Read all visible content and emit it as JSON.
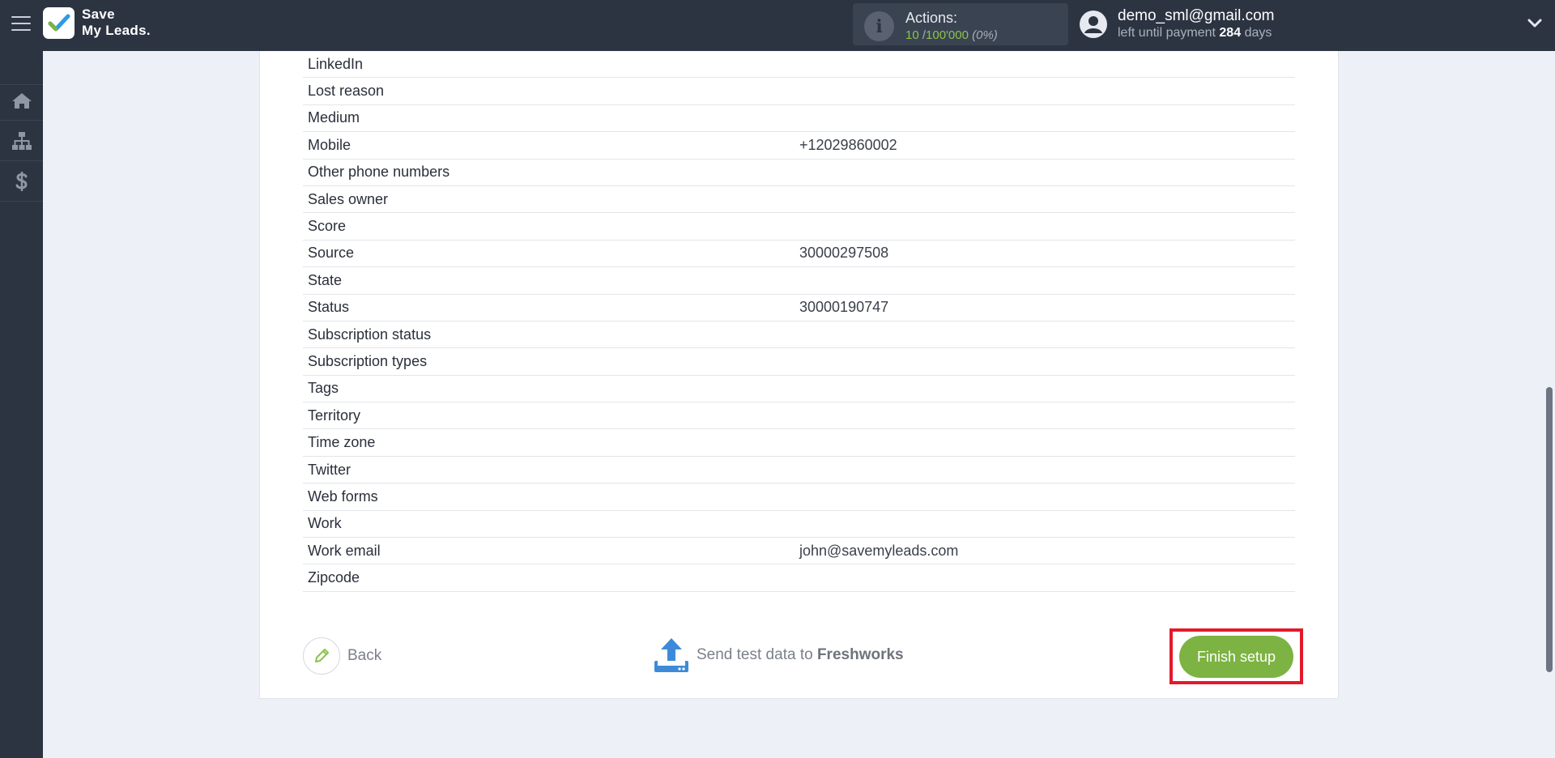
{
  "brand": {
    "line1": "Save",
    "line2": "My Leads."
  },
  "actions": {
    "label": "Actions:",
    "used": "10",
    "separator": "/",
    "total": "100'000",
    "percent": "(0%)"
  },
  "user": {
    "email": "demo_sml@gmail.com",
    "payment_prefix": "left until payment",
    "days": "284",
    "days_suffix": "days"
  },
  "sidebar": {
    "items": [
      {
        "icon": "home-icon"
      },
      {
        "icon": "sitemap-icon"
      },
      {
        "icon": "dollar-icon"
      }
    ]
  },
  "fields": [
    {
      "name": "LinkedIn",
      "value": ""
    },
    {
      "name": "Lost reason",
      "value": ""
    },
    {
      "name": "Medium",
      "value": ""
    },
    {
      "name": "Mobile",
      "value": "+12029860002"
    },
    {
      "name": "Other phone numbers",
      "value": ""
    },
    {
      "name": "Sales owner",
      "value": ""
    },
    {
      "name": "Score",
      "value": ""
    },
    {
      "name": "Source",
      "value": "30000297508"
    },
    {
      "name": "State",
      "value": ""
    },
    {
      "name": "Status",
      "value": "30000190747"
    },
    {
      "name": "Subscription status",
      "value": ""
    },
    {
      "name": "Subscription types",
      "value": ""
    },
    {
      "name": "Tags",
      "value": ""
    },
    {
      "name": "Territory",
      "value": ""
    },
    {
      "name": "Time zone",
      "value": ""
    },
    {
      "name": "Twitter",
      "value": ""
    },
    {
      "name": "Web forms",
      "value": ""
    },
    {
      "name": "Work",
      "value": ""
    },
    {
      "name": "Work email",
      "value": "john@savemyleads.com"
    },
    {
      "name": "Zipcode",
      "value": ""
    }
  ],
  "footer": {
    "back_label": "Back",
    "send_prefix": "Send test data to",
    "send_target": "Freshworks",
    "finish_label": "Finish setup"
  },
  "colors": {
    "topbar": "#2c3442",
    "accent_green": "#7db342",
    "highlight_red": "#e3192b"
  }
}
